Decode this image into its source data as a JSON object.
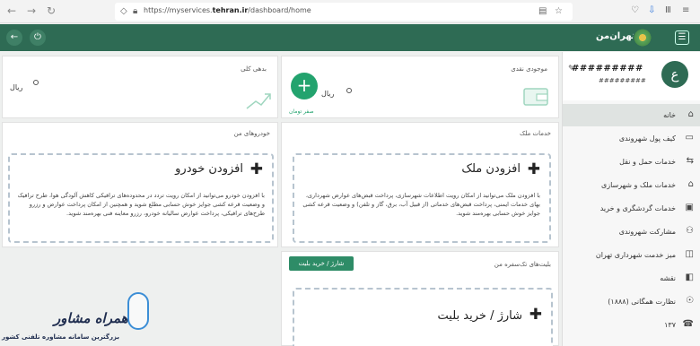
{
  "browser": {
    "back": "←",
    "forward": "→",
    "reload": "↻",
    "url_prefix": "https://myservices.",
    "url_domain": "tehran.ir",
    "url_path": "/dashboard/home"
  },
  "header": {
    "logo_text": "تهران‌من",
    "menu_icon": "☰",
    "back_icon": "←",
    "power_icon": "⏻"
  },
  "profile": {
    "avatar_letter": "ع",
    "name": "#########",
    "sub": "#########"
  },
  "sidebar": {
    "items": [
      {
        "label": "خانه",
        "icon": "⌂",
        "active": true
      },
      {
        "label": "کیف پول شهروندی",
        "icon": "▭"
      },
      {
        "label": "خدمات حمل و نقل",
        "icon": "⇆"
      },
      {
        "label": "خدمات ملک و شهرسازی",
        "icon": "⌂"
      },
      {
        "label": "خدمات گردشگری و خرید",
        "icon": "▣"
      },
      {
        "label": "مشارکت شهروندی",
        "icon": "⚇"
      },
      {
        "label": "میز خدمت شهرداری تهران",
        "icon": "◫"
      },
      {
        "label": "نقشه",
        "icon": "◧"
      },
      {
        "label": "نظارت همگانی (۱۸۸۸)",
        "icon": "☉"
      },
      {
        "label": "۱۳۷",
        "icon": "☎"
      }
    ]
  },
  "cards": {
    "cash": {
      "title": "موجودی نقدی",
      "rial": "ریال",
      "plus": "+",
      "zero_toman": "صفر تومان"
    },
    "debt": {
      "title": "بدهی کلی",
      "rial": "ریال"
    },
    "property": {
      "title": "خدمات ملک",
      "add_label": "افزودن ملک",
      "desc": "با افزودن ملک می‌توانید از امکان رویت اطلاعات شهرسازی، پرداخت قبض‌های عوارض شهرداری، بهای خدمات ایمنی، پرداخت قبض‌های خدماتی (از قبیل آب، برق، گاز و تلفن) و وضعیت قرعه کشی جوایز خوش حسابی بهره‌مند شوید."
    },
    "vehicle": {
      "title": "خودروهای من",
      "add_label": "افزودن خودرو",
      "desc": "با افزودن خودرو می‌توانید از امکان رویت تردد در محدوده‌های ترافیکی کاهش آلودگی هوا، طرح ترافیک و وضعیت قرعه کشی جوایز خوش حسابی مطلع شوید و همچنین از امکان پرداخت عوارض و رزرو طرح‌های ترافیکی، پرداخت عوارض سالیانه خودرو، رزرو معاینه فنی بهره‌مند شوید."
    },
    "tickets": {
      "title": "بلیت‌های تک‌سفره من",
      "button": "شارژ / خرید بلیت",
      "add_label": "شارژ / خرید بلیت"
    }
  },
  "watermark": {
    "title": "همراه مشاور",
    "subtitle": "بزرگترین سامانه مشاوره تلفنی کشور"
  }
}
